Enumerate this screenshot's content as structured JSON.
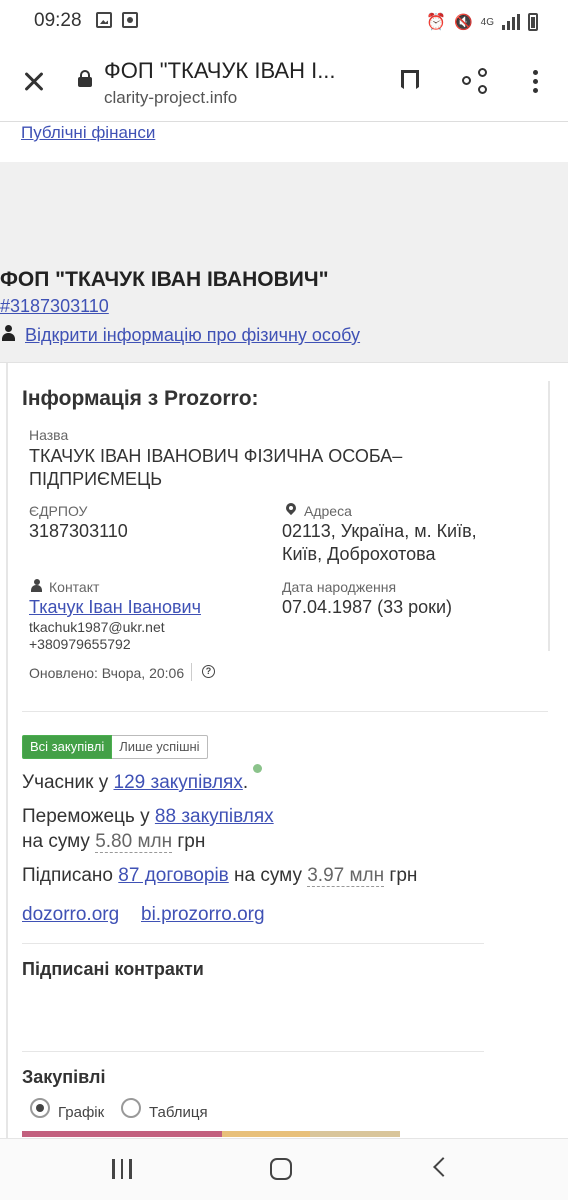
{
  "status_bar": {
    "time": "09:28",
    "network": "4G"
  },
  "browser": {
    "title": "ФОП \"ТКАЧУК ІВАН І...",
    "url": "clarity-project.info"
  },
  "page": {
    "breadcrumb_link": "Публічні фінанси",
    "entity_title": "ФОП \"ТКАЧУК ІВАН ІВАНОВИЧ\"",
    "entity_id": "#3187303110",
    "person_link": "Відкрити інформацію про фізичну особу"
  },
  "prozorro": {
    "heading": "Інформація з Prozorro:",
    "name_label": "Назва",
    "name_line1": "ТКАЧУК ІВАН ІВАНОВИЧ ФІЗИЧНА ОСОБА–",
    "name_line2": "ПІДПРИЄМЕЦЬ",
    "edrpou_label": "ЄДРПОУ",
    "edrpou_value": "3187303110",
    "address_label": "Адреса",
    "address_line1": "02113, Україна, м. Київ,",
    "address_line2": "Київ, Доброхотова",
    "contact_label": "Контакт",
    "contact_name": "Ткачук Іван Іванович",
    "contact_email": "tkachuk1987@ukr.net",
    "contact_phone": "+380979655792",
    "birth_label": "Дата народження",
    "birth_value": "07.04.1987 (33 роки)",
    "updated": "Оновлено: Вчора, 20:06"
  },
  "tabs": {
    "all": "Всі закупівлі",
    "successful": "Лише успішні"
  },
  "stats": {
    "participant_prefix": "Учасник у",
    "participant_link": "129 закупівлях",
    "participant_suffix": ".",
    "winner_prefix": "Переможець у",
    "winner_link": "88 закупівлях",
    "winner_sum_prefix": "на суму",
    "winner_sum_amount": "5.80 млн",
    "winner_sum_currency": "грн",
    "signed_prefix": "Підписано",
    "signed_link": "87 договорів",
    "signed_sum_prefix": "на суму",
    "signed_sum_amount": "3.97 млн",
    "signed_sum_currency": "грн"
  },
  "links": {
    "dozorro": "dozorro.org",
    "bi": "bi.prozorro.org"
  },
  "sections": {
    "contracts": "Підписані контракти",
    "procurements": "Закупівлі",
    "view_chart": "Графік",
    "view_table": "Таблиця"
  },
  "colors": {
    "link": "#3f51b5",
    "tab_active": "#43a047",
    "bar1": "#c2607e",
    "bar2": "#e8c07a",
    "bar3": "#d9c59a"
  }
}
